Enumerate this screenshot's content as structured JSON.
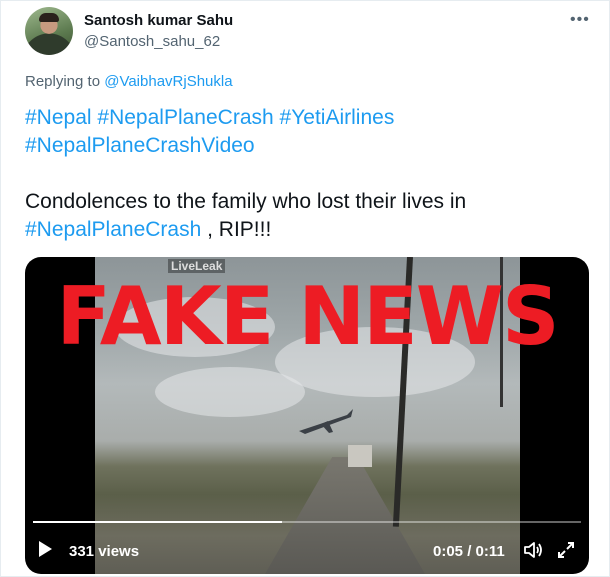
{
  "tweet": {
    "display_name": "Santosh kumar Sahu",
    "handle": "@Santosh_sahu_62",
    "more_icon": "more-icon",
    "replying_prefix": "Replying to ",
    "replying_to": "@VaibhavRjShukla",
    "hashtags_line1": [
      "#Nepal",
      "#NepalPlaneCrash",
      "#YetiAirlines"
    ],
    "hashtags_line2": "#NepalPlaneCrashVideo",
    "body_line1": "Condolences to the family who lost their lives in",
    "body_tag": "#NepalPlaneCrash",
    "body_suffix": " , RIP!!!"
  },
  "video": {
    "overlay_text": "FAKE NEWS",
    "watermark": "LiveLeak",
    "views": "331 views",
    "time": "0:05 / 0:11",
    "progress": 0.455,
    "icons": [
      "play-icon",
      "volume-icon",
      "fullscreen-icon"
    ]
  }
}
